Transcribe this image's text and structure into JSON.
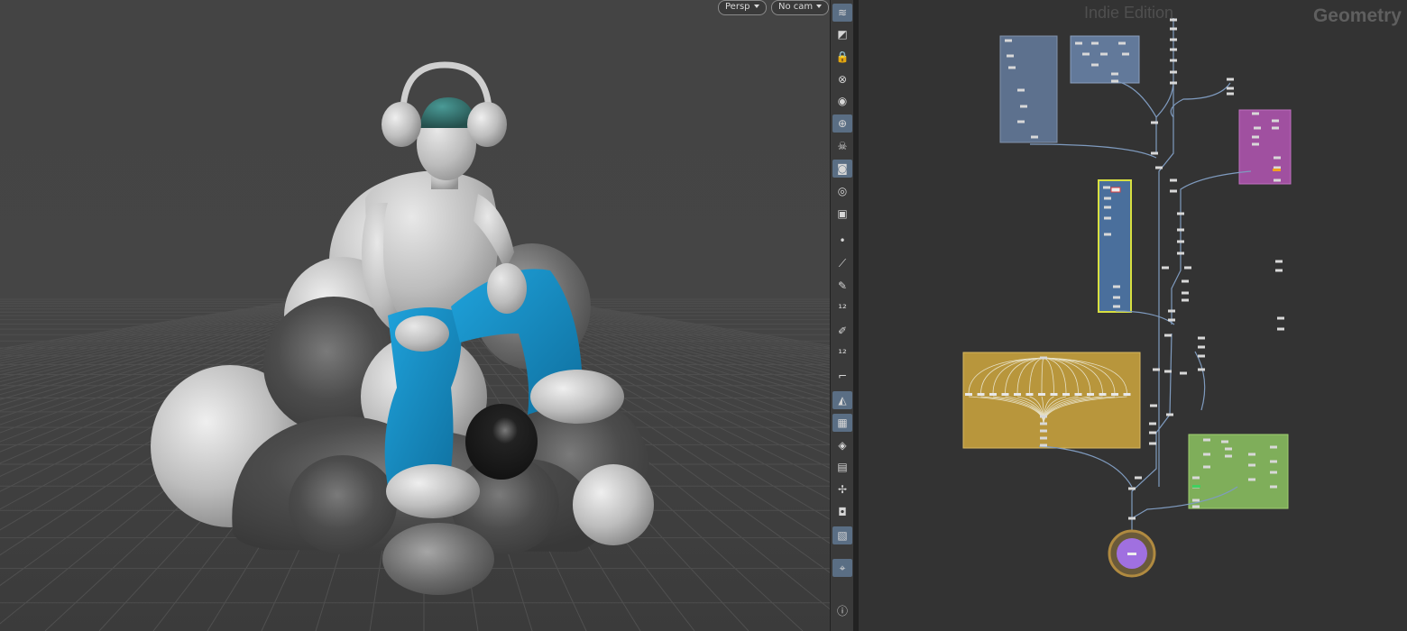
{
  "viewport": {
    "camera_menu": "Persp",
    "cam_menu": "No cam"
  },
  "toolbar": {
    "icons": [
      "display-options-icon",
      "selection-icon",
      "lock-icon",
      "ghost-icon",
      "shading-icon",
      "snap-icon",
      "skull-icon",
      "camera-icon",
      "eye-icon",
      "flipbook-icon",
      "point-icon",
      "line-icon",
      "pen-icon",
      "number-12-icon",
      "brush-icon",
      "number-12b-icon",
      "curve-icon",
      "terrain-icon",
      "checker-icon",
      "diamond-icon",
      "texture-icon",
      "axis-icon",
      "render-icon",
      "image-icon",
      "pin-icon",
      "info-icon"
    ]
  },
  "network": {
    "edition_label": "Indie Edition",
    "context_label": "Geometry"
  },
  "colors": {
    "jeans": "#1a8fc4",
    "hat": "#2f7470",
    "network_box_blue": "#6b86ad",
    "network_box_purple": "#a050a0",
    "network_box_gold": "#b8963c",
    "network_box_green": "#7fae5a",
    "output_node": "#a070e0"
  }
}
